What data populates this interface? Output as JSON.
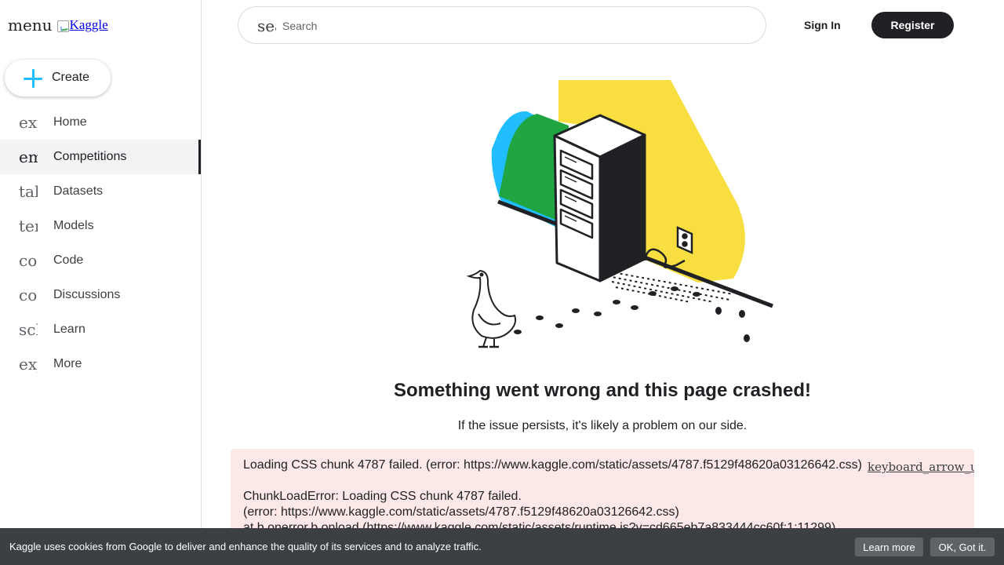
{
  "sidebar": {
    "menu_glyph": "menu",
    "logo_alt": "Kaggle",
    "create_label": "Create",
    "items": [
      {
        "icon": "explore",
        "label": "Home"
      },
      {
        "icon": "emoji_events",
        "label": "Competitions"
      },
      {
        "icon": "table_chart",
        "label": "Datasets"
      },
      {
        "icon": "terminal",
        "label": "Models"
      },
      {
        "icon": "code",
        "label": "Code"
      },
      {
        "icon": "comment",
        "label": "Discussions"
      },
      {
        "icon": "school",
        "label": "Learn"
      },
      {
        "icon": "expand_more",
        "label": "More"
      }
    ],
    "active_index": 1
  },
  "header": {
    "search_icon": "search",
    "search_placeholder": "Search",
    "sign_in_label": "Sign In",
    "register_label": "Register"
  },
  "main": {
    "error_title": "Something went wrong and this page crashed!",
    "error_subtitle": "If the issue persists, it's likely a problem on our side.",
    "error_details": {
      "line1": "Loading CSS chunk 4787 failed. (error: https://www.kaggle.com/static/assets/4787.f5129f48620a03126642.css)",
      "overlay_text": "keyboard_arrow_up content_copy",
      "line2": "ChunkLoadError: Loading CSS chunk 4787 failed.",
      "line3": "(error: https://www.kaggle.com/static/assets/4787.f5129f48620a03126642.css)",
      "line4": "    at b.onerror.b.onload (https://www.kaggle.com/static/assets/runtime.js?v=cd665eb7a833444cc60f:1:11299)"
    }
  },
  "cookie_bar": {
    "text": "Kaggle uses cookies from Google to deliver and enhance the quality of its services and to analyze traffic.",
    "learn_more_label": "Learn more",
    "ok_label": "OK, Got it."
  },
  "colors": {
    "accent_blue": "#20beff",
    "dark": "#202124",
    "error_bg": "#fce8e6",
    "cookie_bg": "#3c4043",
    "illus_yellow": "#f8df3f",
    "illus_green": "#20a543",
    "illus_blue": "#20beff"
  }
}
